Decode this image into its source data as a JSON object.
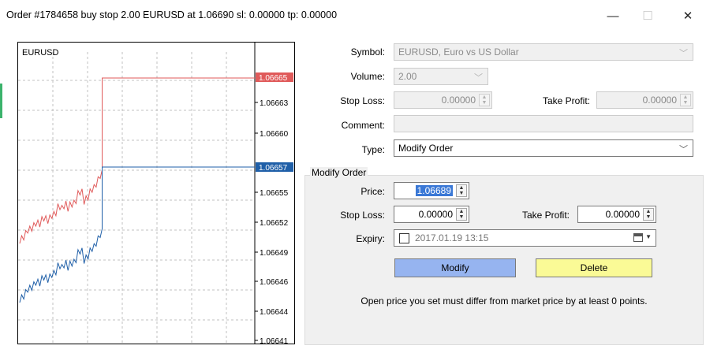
{
  "window": {
    "title": "Order #1784658 buy stop 2.00 EURUSD at 1.06690 sl: 0.00000 tp: 0.00000",
    "minimize": "—",
    "maximize": "☐",
    "close": "✕"
  },
  "chart": {
    "symbol": "EURUSD",
    "price_labels": [
      "1.06663",
      "1.06660",
      "1.06655",
      "1.06652",
      "1.06649",
      "1.06646",
      "1.06644",
      "1.06641"
    ],
    "ask_tag": "1.06665",
    "bid_tag": "1.06657",
    "colors": {
      "ask": "#e05a5a",
      "bid": "#1f5fa8",
      "ask_tag_bg": "#e05a5a",
      "bid_tag_bg": "#1f5fa8"
    }
  },
  "form": {
    "symbol_label": "Symbol:",
    "symbol_value": "EURUSD, Euro vs US Dollar",
    "volume_label": "Volume:",
    "volume_value": "2.00",
    "stoploss_label": "Stop Loss:",
    "stoploss_value": "0.00000",
    "takeprofit_label": "Take Profit:",
    "takeprofit_value": "0.00000",
    "comment_label": "Comment:",
    "comment_value": "",
    "type_label": "Type:",
    "type_value": "Modify Order"
  },
  "modify_group": {
    "title": "Modify Order",
    "price_label": "Price:",
    "price_value": "1.06689",
    "stoploss_label": "Stop Loss:",
    "stoploss_value": "0.00000",
    "takeprofit_label": "Take Profit:",
    "takeprofit_value": "0.00000",
    "expiry_label": "Expiry:",
    "expiry_value": "2017.01.19 13:15",
    "modify_button": "Modify",
    "delete_button": "Delete",
    "message": "Open price you set must differ from market price by at least 0 points.",
    "colors": {
      "modify_bg": "#96b4f0",
      "delete_bg": "#fafa96"
    }
  }
}
